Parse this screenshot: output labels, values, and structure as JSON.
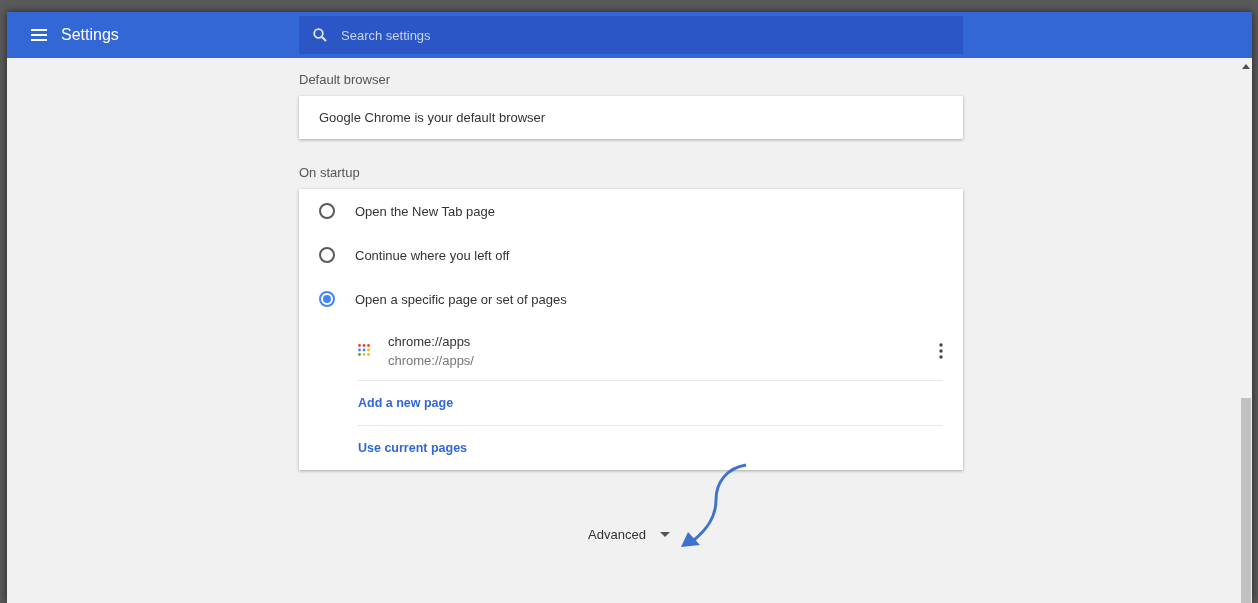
{
  "header": {
    "title": "Settings",
    "search": {
      "placeholder": "Search settings"
    }
  },
  "sections": [
    {
      "kind": "text",
      "title": "Default browser",
      "text": "Google Chrome is your default browser"
    },
    {
      "kind": "startup",
      "title": "On startup",
      "options": [
        {
          "label": "Open the New Tab page",
          "selected": false
        },
        {
          "label": "Continue where you left off",
          "selected": false
        },
        {
          "label": "Open a specific page or set of pages",
          "selected": true
        }
      ],
      "pages": [
        {
          "title": "chrome://apps",
          "url": "chrome://apps/"
        }
      ],
      "links": [
        "Add a new page",
        "Use current pages"
      ]
    }
  ],
  "advanced": {
    "label": "Advanced",
    "expanded": false
  }
}
